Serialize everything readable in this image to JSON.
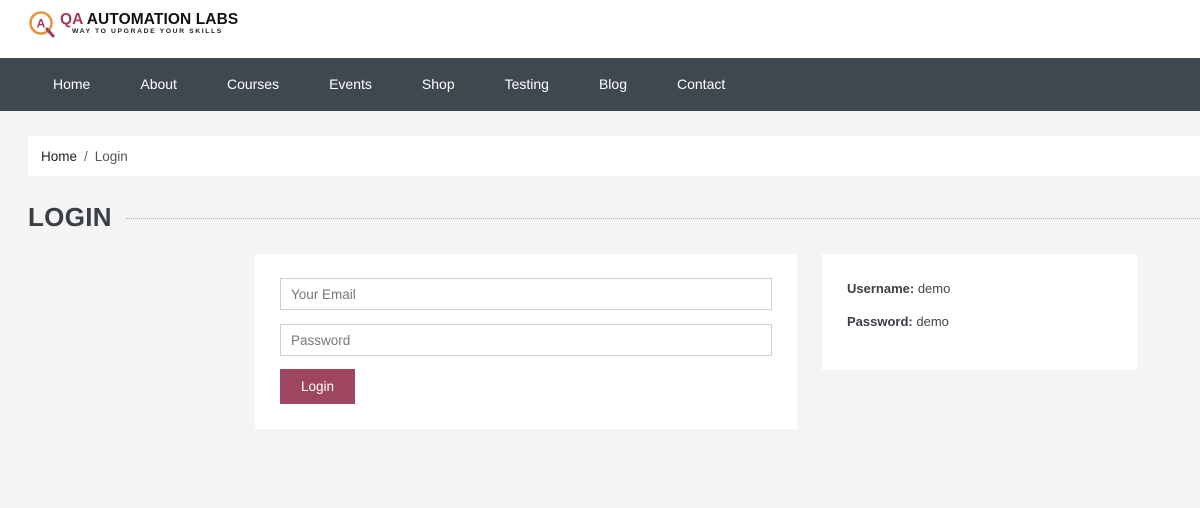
{
  "brand": {
    "prefix": "QA",
    "name": " AUTOMATION LABS",
    "tagline": "WAY TO UPGRADE YOUR SKILLS",
    "accent_color": "#a33b55"
  },
  "nav": {
    "items": [
      "Home",
      "About",
      "Courses",
      "Events",
      "Shop",
      "Testing",
      "Blog",
      "Contact"
    ],
    "background": "#3f4750"
  },
  "breadcrumb": {
    "home": "Home",
    "separator": "/",
    "current": "Login"
  },
  "page": {
    "title": "LOGIN"
  },
  "login_form": {
    "email_placeholder": "Your Email",
    "email_value": "",
    "password_placeholder": "Password",
    "password_value": "",
    "submit_label": "Login",
    "submit_color": "#9e4660"
  },
  "credentials": {
    "username_label": "Username:",
    "username_value": " demo",
    "password_label": "Password:",
    "password_value": " demo"
  }
}
